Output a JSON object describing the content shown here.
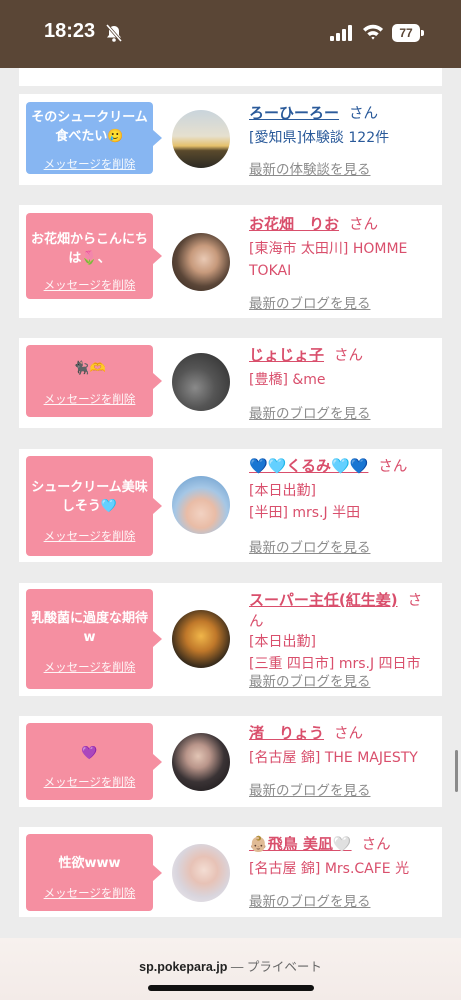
{
  "status_bar": {
    "time": "18:23",
    "battery": "77"
  },
  "cards": [
    {
      "bubble_color": "#87b6f2",
      "message": "そのシュークリーム食べたい🥲",
      "delete_label": "メッセージを削除",
      "name": "ろーひーろー",
      "san": "さん",
      "lines": [
        "[愛知県]体験談 122件"
      ],
      "more": "最新の体験談を見る",
      "name_color": "#2a5a9a"
    },
    {
      "bubble_color": "#f58fa1",
      "message": "お花畑からこんにちは🌷、",
      "delete_label": "メッセージを削除",
      "name": "お花畑　りお",
      "san": "さん",
      "lines": [
        "[東海市 太田川] HOMME",
        "TOKAI"
      ],
      "more": "最新のブログを見る",
      "name_color": "#d94f6c"
    },
    {
      "bubble_color": "#f58fa1",
      "message": "🐈‍⬛🫶",
      "delete_label": "メッセージを削除",
      "name": "じょじょ子",
      "san": "さん",
      "lines": [
        "[豊橋] &me"
      ],
      "more": "最新のブログを見る",
      "name_color": "#d94f6c"
    },
    {
      "bubble_color": "#f58fa1",
      "message": "シュークリーム美味しそう🩵",
      "delete_label": "メッセージを削除",
      "name": "💙🩵くるみ🩵💙",
      "san": "さん",
      "lines": [
        "[本日出勤]",
        "[半田] mrs.J 半田"
      ],
      "more": "最新のブログを見る",
      "name_color": "#d94f6c"
    },
    {
      "bubble_color": "#f58fa1",
      "message": "乳酸菌に過度な期待w",
      "delete_label": "メッセージを削除",
      "name": "スーパー主任(紅生姜)",
      "san": "さん",
      "lines": [
        "[本日出勤]",
        "[三重 四日市] mrs.J 四日市"
      ],
      "more": "最新のブログを見る",
      "name_color": "#d94f6c"
    },
    {
      "bubble_color": "#f58fa1",
      "message": "💜",
      "delete_label": "メッセージを削除",
      "name": "渚　りょう",
      "san": "さん",
      "lines": [
        "[名古屋 錦] THE MAJESTY"
      ],
      "more": "最新のブログを見る",
      "name_color": "#d94f6c"
    },
    {
      "bubble_color": "#f58fa1",
      "message": "性欲www",
      "delete_label": "メッセージを削除",
      "name": "👶🏼飛鳥 美凪🤍",
      "san": "さん",
      "lines": [
        "[名古屋 錦] Mrs.CAFE 光"
      ],
      "more": "最新のブログを見る",
      "name_color": "#d94f6c"
    }
  ],
  "browser_bar": {
    "domain": "sp.pokepara.jp",
    "separator": " — ",
    "mode": "プライベート"
  }
}
